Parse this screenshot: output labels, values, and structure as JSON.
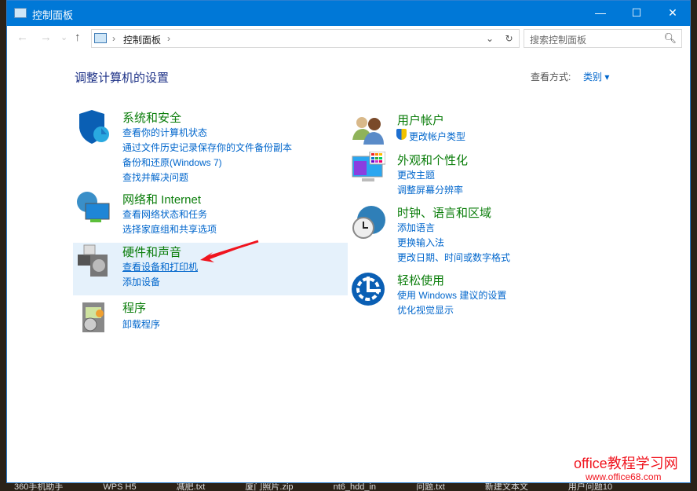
{
  "window": {
    "title": "控制面板",
    "minimize": "—",
    "maximize": "☐",
    "close": "✕"
  },
  "nav": {
    "back": "←",
    "forward": "→",
    "recent": "⌄",
    "up": "↑",
    "sep": "›",
    "crumb": "控制面板",
    "dropdown": "⌄",
    "refresh": "↻"
  },
  "search": {
    "placeholder": "搜索控制面板",
    "icon": "search-icon"
  },
  "heading": "调整计算机的设置",
  "view": {
    "label": "查看方式:",
    "value": "类别 ▾"
  },
  "left": [
    {
      "title": "系统和安全",
      "icon": "shield-icon",
      "links": [
        "查看你的计算机状态",
        "通过文件历史记录保存你的文件备份副本",
        "备份和还原(Windows 7)",
        "查找并解决问题"
      ]
    },
    {
      "title": "网络和 Internet",
      "icon": "network-icon",
      "links": [
        "查看网络状态和任务",
        "选择家庭组和共享选项"
      ]
    },
    {
      "title": "硬件和声音",
      "icon": "printer-icon",
      "links": [
        "查看设备和打印机",
        "添加设备"
      ]
    },
    {
      "title": "程序",
      "icon": "programs-icon",
      "links": [
        "卸载程序"
      ]
    }
  ],
  "right": [
    {
      "title": "用户帐户",
      "icon": "users-icon",
      "links": [
        "更改帐户类型"
      ]
    },
    {
      "title": "外观和个性化",
      "icon": "monitor-icon",
      "links": [
        "更改主题",
        "调整屏幕分辨率"
      ]
    },
    {
      "title": "时钟、语言和区域",
      "icon": "clock-globe-icon",
      "links": [
        "添加语言",
        "更换输入法",
        "更改日期、时间或数字格式"
      ]
    },
    {
      "title": "轻松使用",
      "icon": "ease-of-access-icon",
      "links": [
        "使用 Windows 建议的设置",
        "优化视觉显示"
      ]
    }
  ],
  "taskbar": [
    "360手机助手",
    "WPS H5",
    "减肥.txt",
    "厦门照片.zip",
    "nt6_hdd_in",
    "问题.txt",
    "新建文本文",
    "用户问题10"
  ],
  "watermark": {
    "line1": "office教程学习网",
    "line2": "www.office68.com"
  },
  "colors": {
    "titlebar": "#0078d7",
    "category": "#0a7d0a",
    "link": "#0066cc",
    "highlight": "#e5f1fb",
    "arrow": "#f0141e"
  }
}
